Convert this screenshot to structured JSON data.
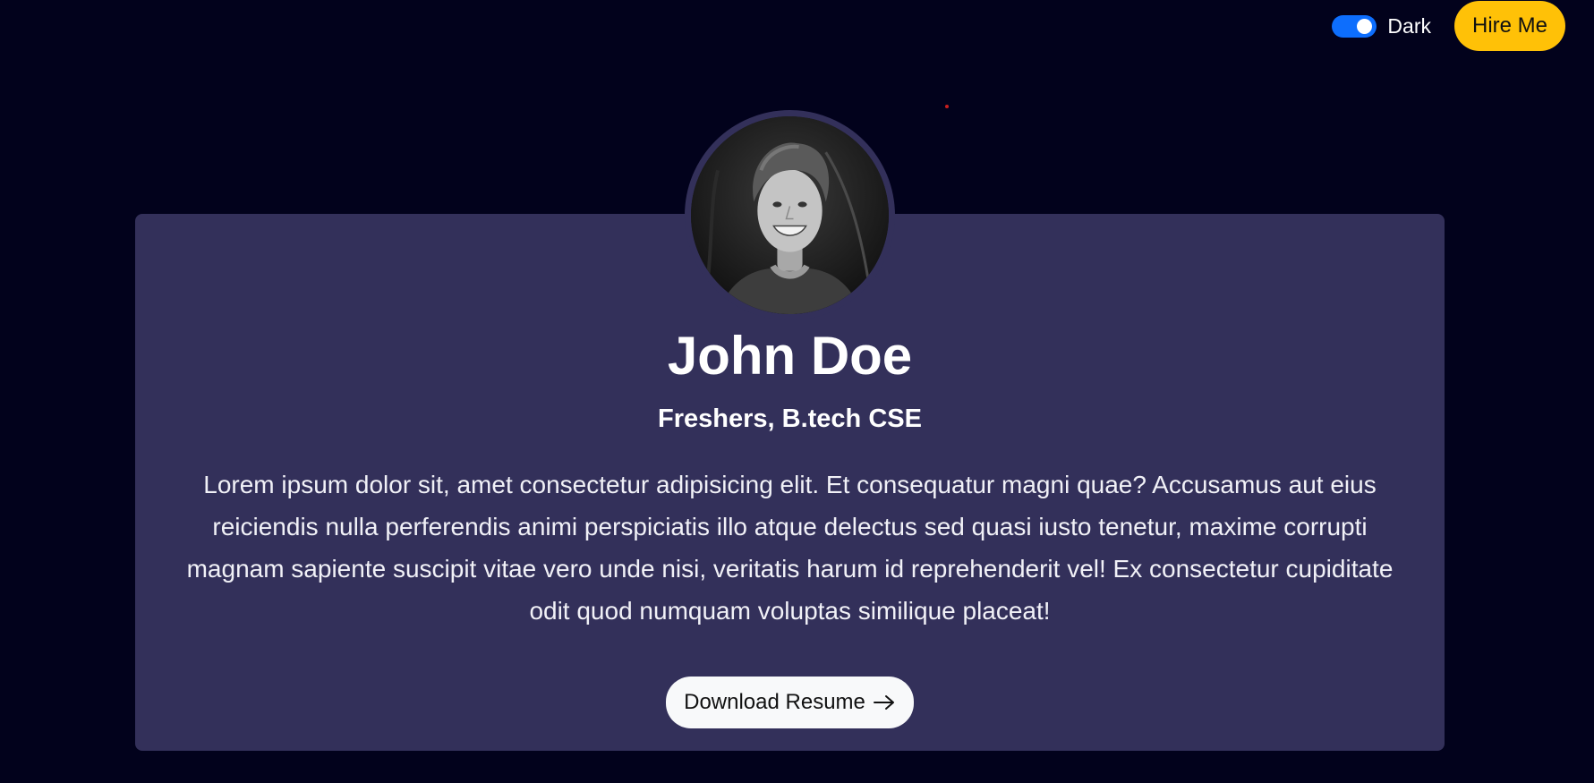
{
  "topbar": {
    "theme_label": "Dark",
    "hire_label": "Hire Me"
  },
  "profile": {
    "name": "John Doe",
    "subtitle": "Freshers, B.tech CSE",
    "bio": "Lorem ipsum dolor sit, amet consectetur adipisicing elit. Et consequatur magni quae? Accusamus aut eius reiciendis nulla perferendis animi perspiciatis illo atque delectus sed quasi iusto tenetur, maxime corrupti magnam sapiente suscipit vitae vero unde nisi, veritatis harum id reprehenderit vel! Ex consectetur cupiditate odit quod numquam voluptas similique placeat!",
    "download_label": "Download Resume"
  },
  "icons": {
    "download_arrow": "arrow-right-icon",
    "toggle": "toggle-switch-icon"
  },
  "colors": {
    "background": "#02021c",
    "card": "#33305a",
    "hire_button": "#ffc107",
    "toggle_on": "#0d6efd"
  }
}
